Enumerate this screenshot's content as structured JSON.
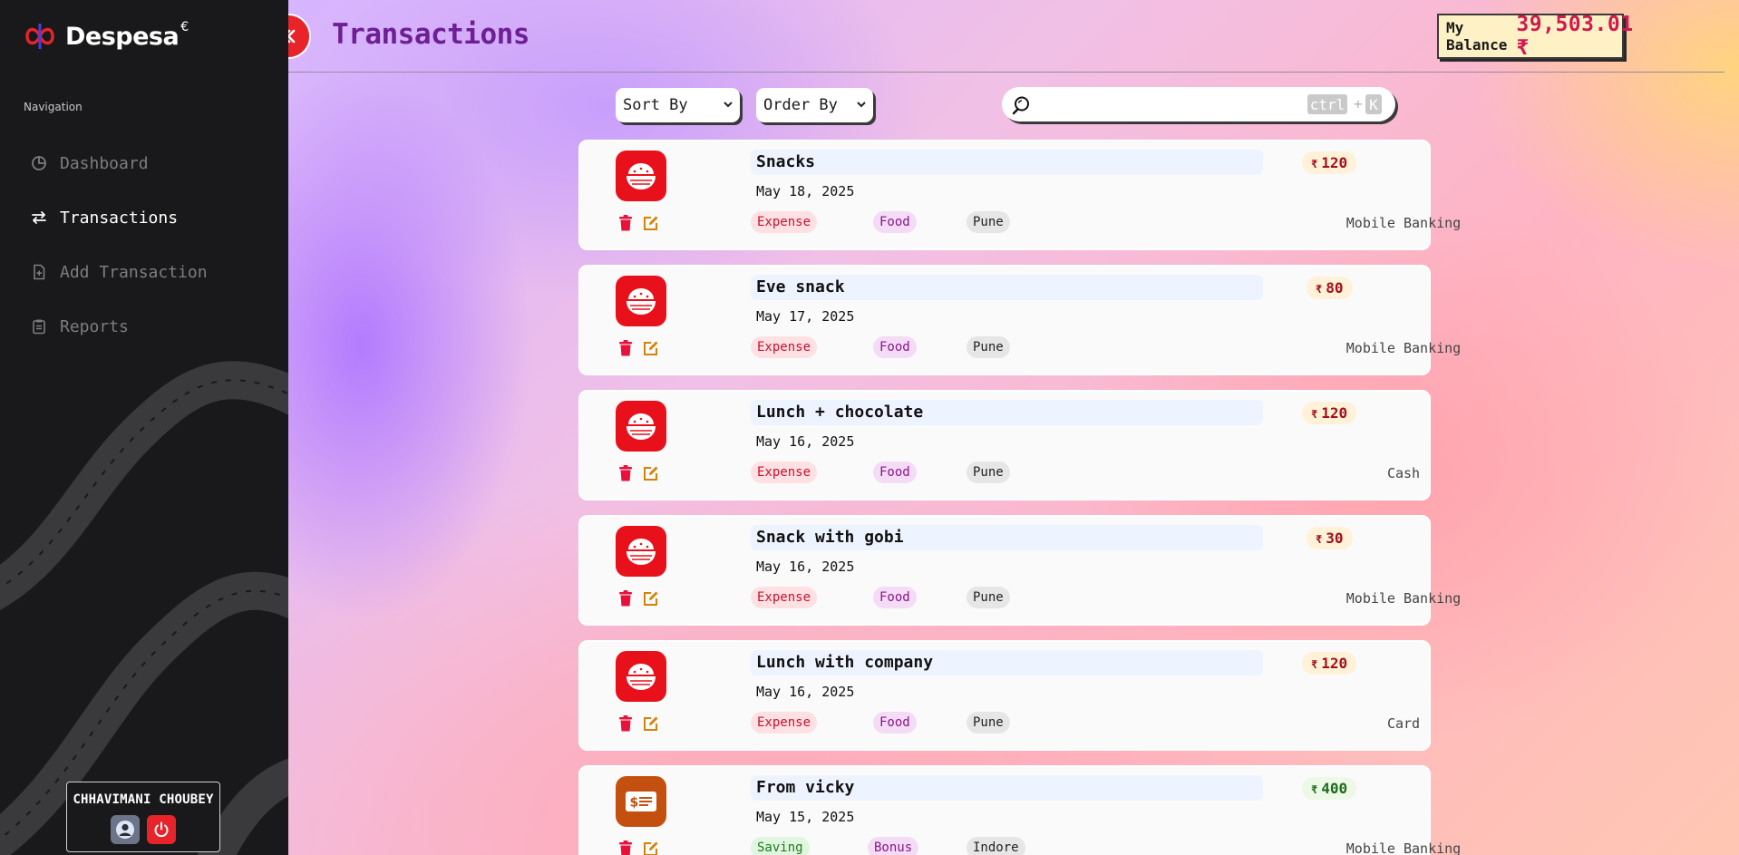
{
  "app": {
    "name": "Despesa",
    "superscript": "€"
  },
  "sidebar": {
    "nav_heading": "Navigation",
    "items": [
      {
        "label": "Dashboard",
        "icon": "pie-chart-icon",
        "active": false
      },
      {
        "label": "Transactions",
        "icon": "arrows-swap-icon",
        "active": true
      },
      {
        "label": "Add Transaction",
        "icon": "file-plus-icon",
        "active": false
      },
      {
        "label": "Reports",
        "icon": "clipboard-icon",
        "active": false
      }
    ],
    "user": {
      "name": "CHHAVIMANI CHOUBEY"
    }
  },
  "header": {
    "title": "Transactions",
    "balance_label": "My Balance",
    "balance_value": "39,503.01 ₹"
  },
  "filters": {
    "sort_label": "Sort By",
    "order_label": "Order By",
    "search_placeholder": "",
    "shortcut_key1": "ctrl",
    "shortcut_plus": "+",
    "shortcut_key2": "K"
  },
  "colors": {
    "accent_red": "#e8242a",
    "title_purple": "#6d1f93",
    "balance_pink": "#d11950",
    "food_icon_bg": "#e8111b",
    "saving_icon_bg": "#c4500f"
  },
  "transactions": [
    {
      "title": "Snacks",
      "date": "May 18, 2025",
      "type": "Expense",
      "category": "Food",
      "city": "Pune",
      "currency": "₹",
      "amount": "120",
      "method": "Mobile Banking",
      "icon": "rice-bowl-icon"
    },
    {
      "title": "Eve snack",
      "date": "May 17, 2025",
      "type": "Expense",
      "category": "Food",
      "city": "Pune",
      "currency": "₹",
      "amount": "80",
      "method": "Mobile Banking",
      "icon": "rice-bowl-icon"
    },
    {
      "title": "Lunch + chocolate",
      "date": "May 16, 2025",
      "type": "Expense",
      "category": "Food",
      "city": "Pune",
      "currency": "₹",
      "amount": "120",
      "method": "Cash",
      "icon": "rice-bowl-icon"
    },
    {
      "title": "Snack with gobi",
      "date": "May 16, 2025",
      "type": "Expense",
      "category": "Food",
      "city": "Pune",
      "currency": "₹",
      "amount": "30",
      "method": "Mobile Banking",
      "icon": "rice-bowl-icon"
    },
    {
      "title": "Lunch with company",
      "date": "May 16, 2025",
      "type": "Expense",
      "category": "Food",
      "city": "Pune",
      "currency": "₹",
      "amount": "120",
      "method": "Card",
      "icon": "rice-bowl-icon"
    },
    {
      "title": "From vicky",
      "date": "May 15, 2025",
      "type": "Saving",
      "category": "Bonus",
      "city": "Indore",
      "currency": "₹",
      "amount": "400",
      "method": "Mobile Banking",
      "icon": "money-bill-icon"
    }
  ]
}
